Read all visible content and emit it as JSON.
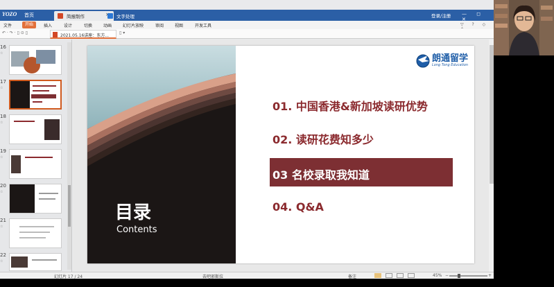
{
  "app": {
    "logo": "YOZO",
    "home_tab": "首页",
    "tabs": [
      {
        "label": "简报制作",
        "close": "×"
      },
      {
        "label": "文字处理"
      }
    ],
    "login": "登录/注册",
    "window_controls": "— ◻ ✕"
  },
  "menu": {
    "items": [
      "文件",
      "开始",
      "插入",
      "设计",
      "切换",
      "动画",
      "幻灯片放映",
      "审阅",
      "视图",
      "开发工具"
    ],
    "right_icons": "▽ ? ◇ ⌃"
  },
  "toolbar": {
    "quick_icons": "↶ · ↷ · ▯ ⊙ ▯",
    "doc_tab": "2021.05.16讲座：东方...",
    "new_doc": "▯ ▾"
  },
  "thumbnails": [
    {
      "num": "16",
      "star": "☆",
      "selected": false
    },
    {
      "num": "17",
      "star": "☆",
      "selected": true
    },
    {
      "num": "18",
      "star": "☆",
      "selected": false
    },
    {
      "num": "19",
      "star": "☆",
      "selected": false
    },
    {
      "num": "20",
      "star": "☆",
      "selected": false
    },
    {
      "num": "21",
      "star": "☆",
      "selected": false
    },
    {
      "num": "22",
      "star": "☆",
      "selected": false
    }
  ],
  "slide": {
    "title_cn": "目录",
    "title_en": "Contents",
    "brand_cn": "朗通留学",
    "brand_en": "Long Tong Education",
    "toc": [
      {
        "label": "01.  中国香港&新加坡读研优势",
        "active": false
      },
      {
        "label": "02.  读研花费知多少",
        "active": false
      },
      {
        "label": "03   名校录取我知道",
        "active": true
      },
      {
        "label": "04.  Q&A",
        "active": false
      }
    ]
  },
  "status": {
    "slide_counter": "幻灯片 17 / 24",
    "theme": "去吧邪斯拉",
    "notes_label": "备注",
    "zoom": "45%",
    "zoom_minus": "−",
    "zoom_plus": "+"
  },
  "colors": {
    "accent": "#e2703a",
    "tab_bar": "#2b5fa6",
    "toc_text": "#8b2a2e",
    "toc_highlight": "#7d2f33",
    "brand_blue": "#1f5ea8"
  }
}
